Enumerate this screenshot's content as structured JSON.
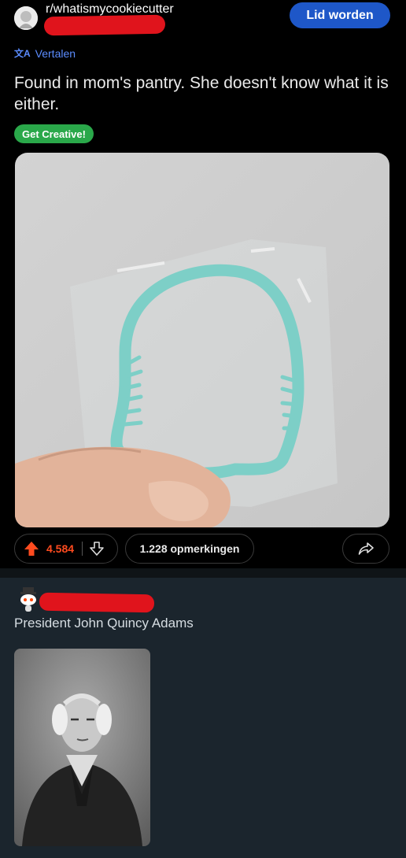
{
  "post": {
    "subreddit": "r/whatismycookiecutter",
    "join_label": "Lid worden",
    "translate_label": "Vertalen",
    "translate_icon": "translate-icon",
    "title": "Found in mom's pantry. She doesn't know what it is either.",
    "flair": "Get Creative!",
    "image_alt": "Turquoise cookie cutter in plastic bag",
    "score": "4.584",
    "comments_label": "1.228 opmerkingen",
    "colors": {
      "join": "#1e57c8",
      "flair": "#2aa84a",
      "upvote": "#ff4b1f",
      "link": "#5b8cff"
    }
  },
  "comment": {
    "text": "President John Quincy Adams",
    "image_alt": "Portrait of John Quincy Adams"
  }
}
